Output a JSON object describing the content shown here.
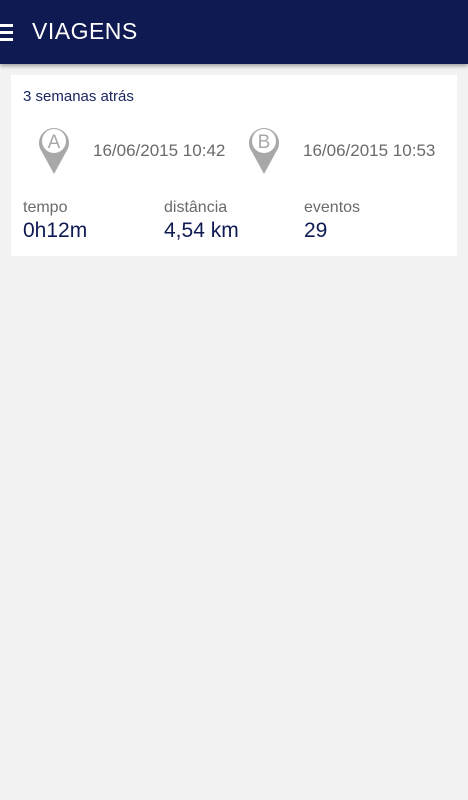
{
  "header": {
    "title": "VIAGENS",
    "menu_icon": "hamburger-menu-icon",
    "bg_color": "#0f1a52"
  },
  "trip": {
    "time_ago": "3 semanas atrás",
    "start": {
      "marker": "A",
      "datetime": "16/06/2015 10:42"
    },
    "end": {
      "marker": "B",
      "datetime": "16/06/2015 10:53"
    },
    "stats": [
      {
        "label": "tempo",
        "value": "0h12m"
      },
      {
        "label": "distância",
        "value": "4,54 km"
      },
      {
        "label": "eventos",
        "value": "29"
      }
    ]
  },
  "colors": {
    "accent": "#0f1a52",
    "background": "#f2f2f2",
    "pin": "#a8a8a8"
  }
}
